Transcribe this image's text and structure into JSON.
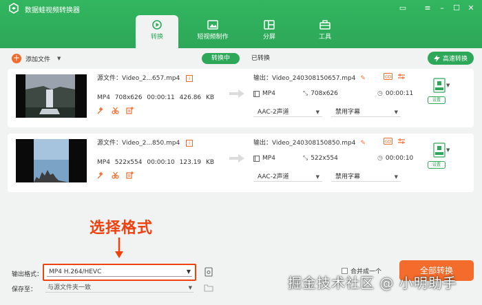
{
  "app": {
    "title": "数据蛙视频转换器"
  },
  "window_controls": [
    "restore",
    "minimize",
    "maximize",
    "close"
  ],
  "tabs": [
    {
      "label": "转换",
      "icon": "convert-icon",
      "active": true
    },
    {
      "label": "短视频制作",
      "icon": "short-video-icon",
      "active": false
    },
    {
      "label": "分屏",
      "icon": "split-screen-icon",
      "active": false
    },
    {
      "label": "工具",
      "icon": "toolbox-icon",
      "active": false
    }
  ],
  "toolbar": {
    "add_file": "添加文件",
    "converting": "转换中",
    "converted": "已转换",
    "fast_convert": "高速转换"
  },
  "files": [
    {
      "source_name": "源文件：Video_2...657.mp4",
      "format": "MP4",
      "resolution": "708x626",
      "duration": "00:00:11",
      "size": "426.86 KB",
      "output_name": "输出：Video_240308150657.mp4",
      "out_format": "MP4",
      "out_resolution": "708x626",
      "out_duration": "00:00:11",
      "audio": "AAC-2声道",
      "subtitle": "禁用字幕",
      "settings": "设置"
    },
    {
      "source_name": "源文件：Video_2...850.mp4",
      "format": "MP4",
      "resolution": "522x554",
      "duration": "00:00:10",
      "size": "123.19 KB",
      "output_name": "输出：Video_240308150850.mp4",
      "out_format": "MP4",
      "out_resolution": "522x554",
      "out_duration": "00:00:10",
      "audio": "AAC-2声道",
      "subtitle": "禁用字幕",
      "settings": "设置"
    }
  ],
  "annotation": {
    "text": "选择格式"
  },
  "bottom": {
    "output_format_label": "输出格式：",
    "output_format_value": "MP4 H.264/HEVC",
    "save_to_label": "保存至：",
    "save_to_value": "与源文件夹一致",
    "merge_label": "合并成一个",
    "convert_all": "全部转换"
  },
  "watermark": "掘金技术社区 @ 小明助手",
  "colors": {
    "brand_green": "#2da758",
    "accent_orange": "#f46c2c",
    "annotation_red": "#f0400d"
  }
}
